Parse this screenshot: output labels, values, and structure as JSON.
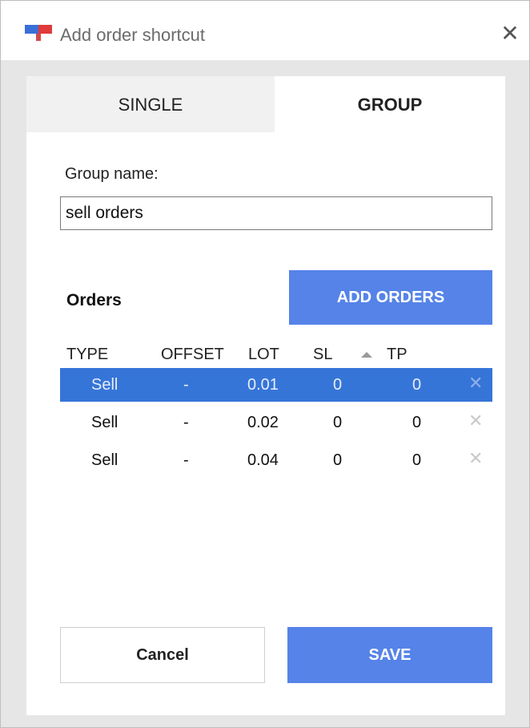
{
  "window": {
    "title": "Add order shortcut",
    "close_glyph": "✕",
    "icon": "app-logo-icon"
  },
  "tabs": [
    {
      "label": "SINGLE",
      "active": false
    },
    {
      "label": "GROUP",
      "active": true
    }
  ],
  "form": {
    "group_name_label": "Group name:",
    "group_name_value": "sell orders"
  },
  "orders": {
    "label": "Orders",
    "add_button": "ADD ORDERS",
    "columns": [
      "TYPE",
      "OFFSET",
      "LOT",
      "SL",
      "TP"
    ],
    "sort_icon": "sort-ascending-icon",
    "rows": [
      {
        "type": "Sell",
        "offset": "-",
        "lot": "0.01",
        "sl": "0",
        "tp": "0",
        "selected": true,
        "remove": "✕"
      },
      {
        "type": "Sell",
        "offset": "-",
        "lot": "0.02",
        "sl": "0",
        "tp": "0",
        "selected": false,
        "remove": "✕"
      },
      {
        "type": "Sell",
        "offset": "-",
        "lot": "0.04",
        "sl": "0",
        "tp": "0",
        "selected": false,
        "remove": "✕"
      }
    ]
  },
  "footer": {
    "cancel": "Cancel",
    "save": "SAVE"
  },
  "colors": {
    "accent": "#5583e8",
    "selected_row": "#3675d8"
  }
}
